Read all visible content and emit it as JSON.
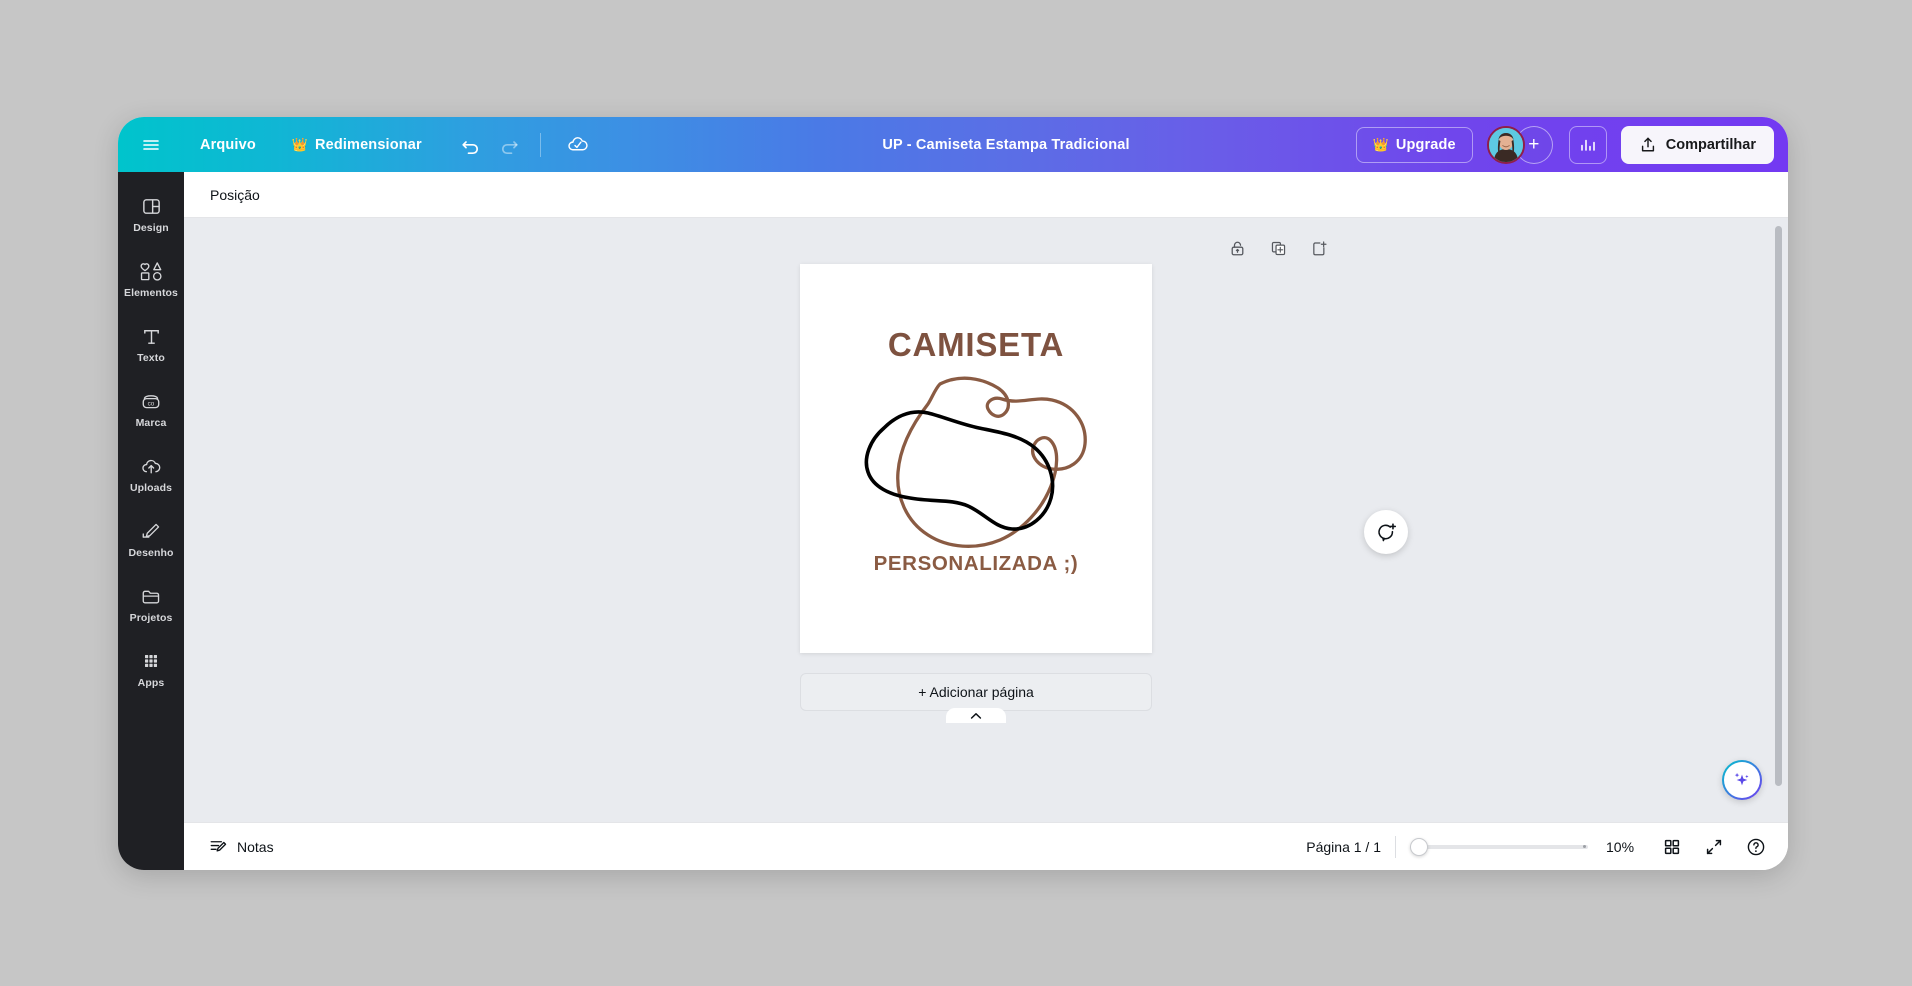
{
  "header": {
    "menu_icon": "hamburger-icon",
    "file_label": "Arquivo",
    "resize_label": "Redimensionar",
    "resize_badge_icon": "crown-icon",
    "undo_icon": "undo-icon",
    "redo_icon": "redo-icon",
    "cloud_icon": "cloud-saved-icon",
    "doc_title": "UP - Camiseta Estampa Tradicional",
    "upgrade_label": "Upgrade",
    "upgrade_icon": "crown-icon",
    "add_member_label": "+",
    "stats_icon": "bar-chart-icon",
    "share_label": "Compartilhar",
    "share_icon": "share-upload-icon",
    "gradient_start": "#00c4cc",
    "gradient_end": "#7339f2"
  },
  "sidebar": {
    "items": [
      {
        "label": "Design",
        "icon": "layout-panel-icon"
      },
      {
        "label": "Elementos",
        "icon": "shapes-icon"
      },
      {
        "label": "Texto",
        "icon": "text-t-icon"
      },
      {
        "label": "Marca",
        "icon": "brand-kit-icon"
      },
      {
        "label": "Uploads",
        "icon": "cloud-upload-icon"
      },
      {
        "label": "Desenho",
        "icon": "pen-draw-icon"
      },
      {
        "label": "Projetos",
        "icon": "folder-icon"
      },
      {
        "label": "Apps",
        "icon": "grid-apps-icon"
      }
    ]
  },
  "toolbar": {
    "position_label": "Posição"
  },
  "canvas": {
    "page_tools": [
      {
        "name": "lock-icon",
        "title": "Bloquear"
      },
      {
        "name": "duplicate-page-icon",
        "title": "Duplicar página"
      },
      {
        "name": "add-page-icon",
        "title": "Adicionar página"
      }
    ],
    "comment_icon": "add-comment-icon",
    "design": {
      "title": "CAMISETA",
      "subtitle": "PERSONALIZADA ;)",
      "title_color": "#7e5240",
      "subtitle_color": "#8a5b43",
      "blob_black_color": "#000000",
      "blob_brown_color": "#8a5b43",
      "background_color": "#ffffff"
    },
    "add_page_label": "+ Adicionar página",
    "panel_chevron_icon": "chevron-up-icon",
    "magic_icon": "magic-sparkle-icon"
  },
  "bottombar": {
    "notes_label": "Notas",
    "notes_icon": "notes-pencil-icon",
    "page_count": "Página 1 / 1",
    "zoom_value": "10%",
    "grid_icon": "grid-view-icon",
    "expand_icon": "fullscreen-expand-icon",
    "help_icon": "help-question-icon"
  }
}
